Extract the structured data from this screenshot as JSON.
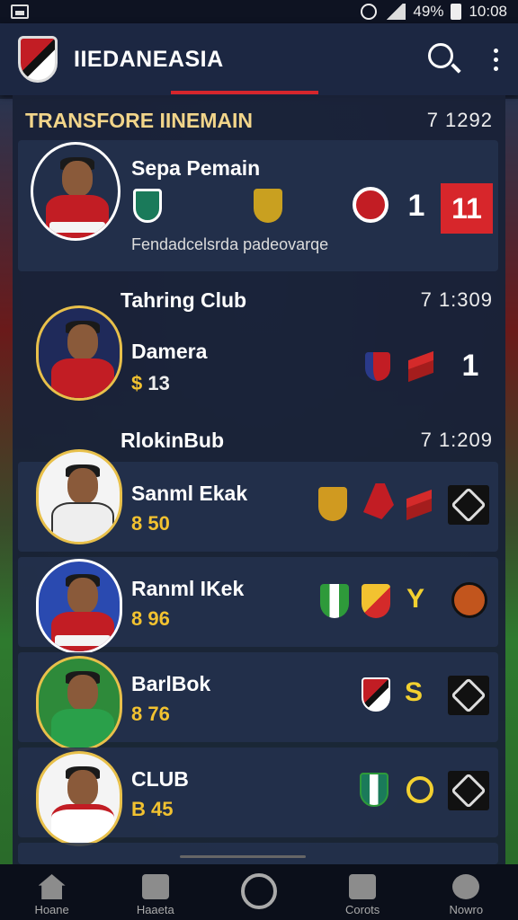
{
  "status_bar": {
    "battery_text": "49%",
    "time": "10:08"
  },
  "app_bar": {
    "title": "IIEDANEASIA"
  },
  "sections": [
    {
      "title": "TRANSFORE IINEMAIN",
      "meta": "7  1292"
    },
    {
      "title": "Tahring Club",
      "meta": "7  1:309"
    },
    {
      "title": "RlokinBub",
      "meta": "7  1:209"
    }
  ],
  "players": [
    {
      "name": "Sepa Pemain",
      "subtitle": "Fendadcelsrda padeovarqe",
      "number": "1",
      "box": "11"
    },
    {
      "name": "Damera",
      "value": "13",
      "number": "1"
    },
    {
      "name": "Sanml Ekak",
      "value": "8 50"
    },
    {
      "name": "Ranml IKek",
      "value": "8 96"
    },
    {
      "name": "BarlBok",
      "value": "8 76"
    },
    {
      "name": "CLUB",
      "value": "B 45"
    }
  ],
  "nav": [
    {
      "label": "Hoane",
      "icon": "home-icon"
    },
    {
      "label": "Haaeta",
      "icon": "news-icon"
    },
    {
      "label": "",
      "icon": "center-circle-icon"
    },
    {
      "label": "Corots",
      "icon": "club-icon"
    },
    {
      "label": "Nowro",
      "icon": "profile-icon"
    }
  ],
  "colors": {
    "accent": "#d6262c",
    "value": "#f2c230",
    "bar": "#1c2742"
  }
}
